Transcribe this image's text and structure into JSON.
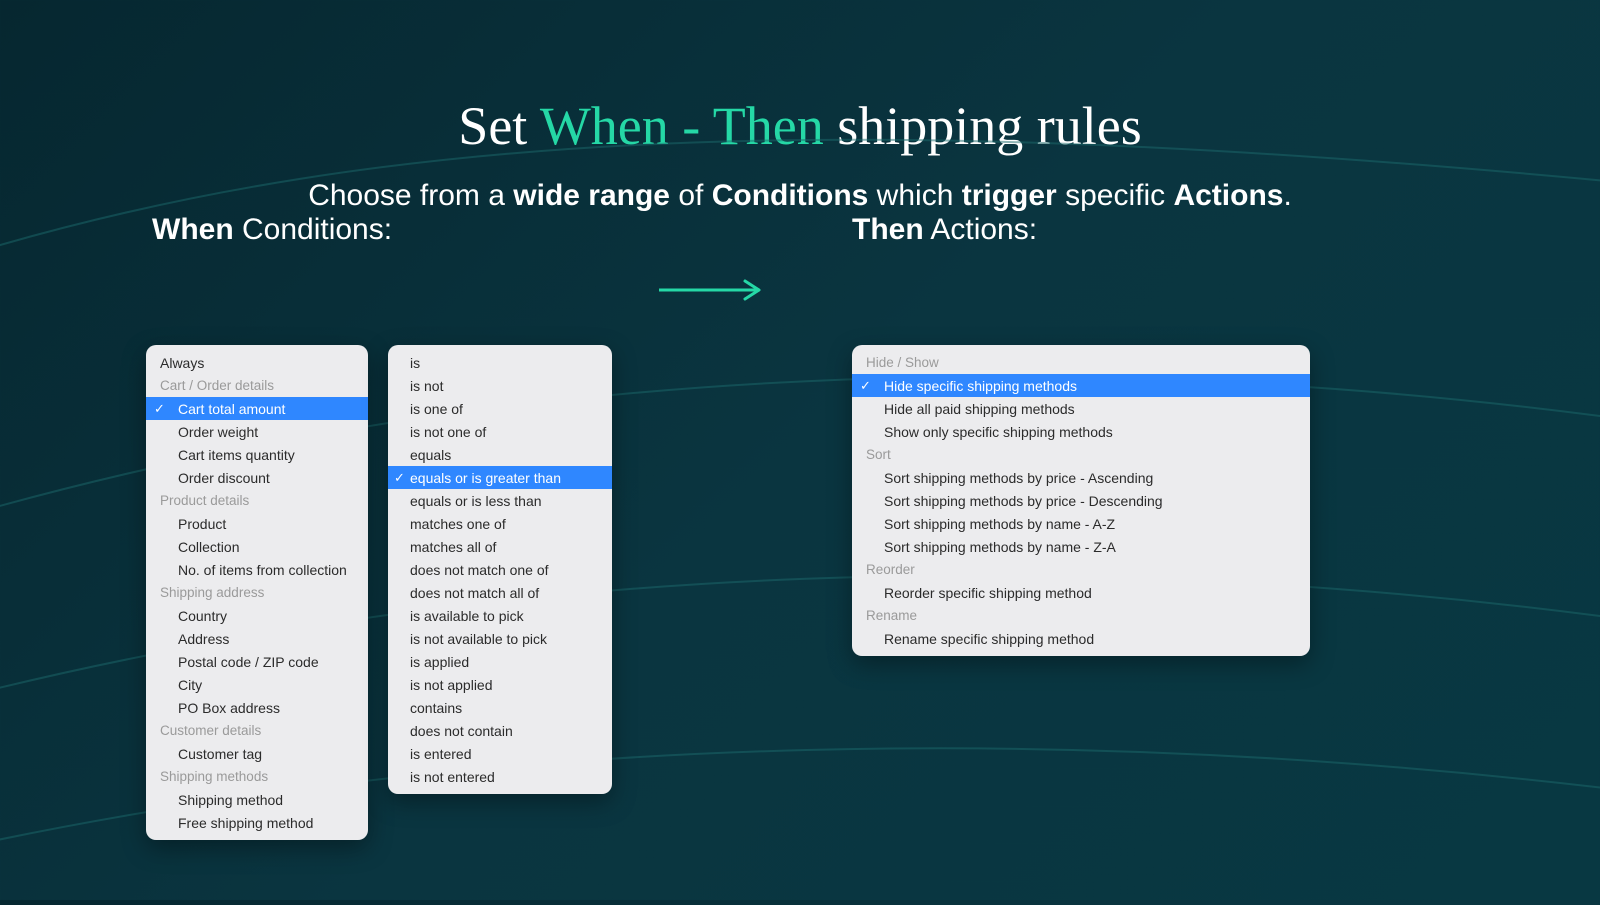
{
  "headline": {
    "pre": "Set ",
    "accent": "When - Then",
    "post": " shipping rules"
  },
  "subhead": {
    "t1": "Choose from a ",
    "b1": "wide range",
    "t2": " of ",
    "b2": "Conditions",
    "t3": " which ",
    "b3": "trigger",
    "t4": " specific ",
    "b4": "Actions",
    "t5": "."
  },
  "labels": {
    "when_bold": "When",
    "when_rest": " Conditions:",
    "then_bold": "Then",
    "then_rest": " Actions:"
  },
  "conditions": {
    "always": "Always",
    "groups": [
      {
        "label": "Cart / Order details",
        "items": [
          "Cart total amount",
          "Order weight",
          "Cart items quantity",
          "Order discount"
        ],
        "selected_index": 0
      },
      {
        "label": "Product details",
        "items": [
          "Product",
          "Collection",
          "No. of items from collection"
        ]
      },
      {
        "label": "Shipping address",
        "items": [
          "Country",
          "Address",
          "Postal code / ZIP code",
          "City",
          "PO Box address"
        ]
      },
      {
        "label": "Customer details",
        "items": [
          "Customer tag"
        ]
      },
      {
        "label": "Shipping methods",
        "items": [
          "Shipping method",
          "Free shipping method"
        ]
      }
    ]
  },
  "operators": {
    "items": [
      "is",
      "is not",
      "is one of",
      "is not one of",
      "equals",
      "equals or is greater than",
      "equals or is less than",
      "matches one of",
      "matches all of",
      "does not match one of",
      "does not match all of",
      "is available to pick",
      "is not available to pick",
      "is applied",
      "is not applied",
      "contains",
      "does not contain",
      "is entered",
      "is not entered"
    ],
    "selected_index": 5
  },
  "actions": {
    "groups": [
      {
        "label": "Hide / Show",
        "items": [
          "Hide specific shipping methods",
          "Hide all paid shipping methods",
          "Show only specific shipping methods"
        ],
        "selected_index": 0
      },
      {
        "label": "Sort",
        "items": [
          "Sort shipping methods by price - Ascending",
          "Sort shipping methods by price - Descending",
          "Sort shipping methods by name - A-Z",
          "Sort shipping methods by name - Z-A"
        ]
      },
      {
        "label": "Reorder",
        "items": [
          "Reorder specific shipping method"
        ]
      },
      {
        "label": "Rename",
        "items": [
          "Rename specific shipping method"
        ]
      }
    ]
  }
}
